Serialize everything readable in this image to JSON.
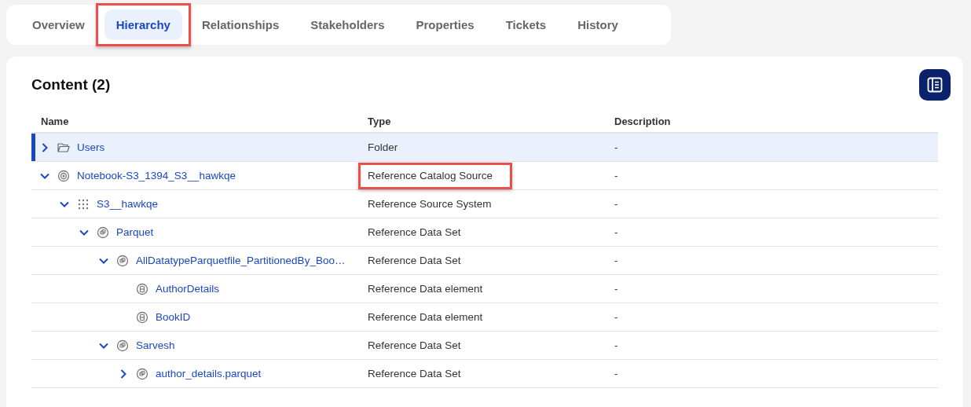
{
  "tabs": [
    {
      "label": "Overview",
      "selected": false,
      "annotated": false
    },
    {
      "label": "Hierarchy",
      "selected": true,
      "annotated": true
    },
    {
      "label": "Relationships",
      "selected": false,
      "annotated": false
    },
    {
      "label": "Stakeholders",
      "selected": false,
      "annotated": false
    },
    {
      "label": "Properties",
      "selected": false,
      "annotated": false
    },
    {
      "label": "Tickets",
      "selected": false,
      "annotated": false
    },
    {
      "label": "History",
      "selected": false,
      "annotated": false
    }
  ],
  "content": {
    "title": "Content (2)",
    "columns": [
      "Name",
      "Type",
      "Description"
    ],
    "rows": [
      {
        "name": "Users",
        "kind": "folder",
        "type": "Folder",
        "description": "-",
        "expanded": false,
        "selected": true,
        "type_annotated": false
      },
      {
        "name": "Notebook-S3_1394_S3__hawkqe",
        "kind": "catalog",
        "type": "Reference Catalog Source",
        "description": "-",
        "expanded": true,
        "selected": false,
        "type_annotated": true,
        "children": [
          {
            "name": "S3__hawkqe",
            "kind": "system",
            "type": "Reference Source System",
            "description": "-",
            "expanded": true,
            "selected": false,
            "type_annotated": false,
            "children": [
              {
                "name": "Parquet",
                "kind": "dataset",
                "type": "Reference Data Set",
                "description": "-",
                "expanded": true,
                "selected": false,
                "type_annotated": false,
                "children": [
                  {
                    "name": "AllDatatypeParquetfile_PartitionedBy_Boo…",
                    "kind": "dataset",
                    "type": "Reference Data Set",
                    "description": "-",
                    "expanded": true,
                    "selected": false,
                    "type_annotated": false,
                    "children": [
                      {
                        "name": "AuthorDetails",
                        "kind": "element",
                        "type": "Reference Data element",
                        "description": "-",
                        "selected": false,
                        "type_annotated": false
                      },
                      {
                        "name": "BookID",
                        "kind": "element",
                        "type": "Reference Data element",
                        "description": "-",
                        "selected": false,
                        "type_annotated": false
                      }
                    ]
                  },
                  {
                    "name": "Sarvesh",
                    "kind": "dataset",
                    "type": "Reference Data Set",
                    "description": "-",
                    "expanded": true,
                    "selected": false,
                    "type_annotated": false,
                    "children": [
                      {
                        "name": "author_details.parquet",
                        "kind": "dataset",
                        "type": "Reference Data Set",
                        "description": "-",
                        "expanded": false,
                        "selected": false,
                        "type_annotated": false
                      }
                    ]
                  }
                ]
              }
            ]
          }
        ]
      }
    ]
  }
}
